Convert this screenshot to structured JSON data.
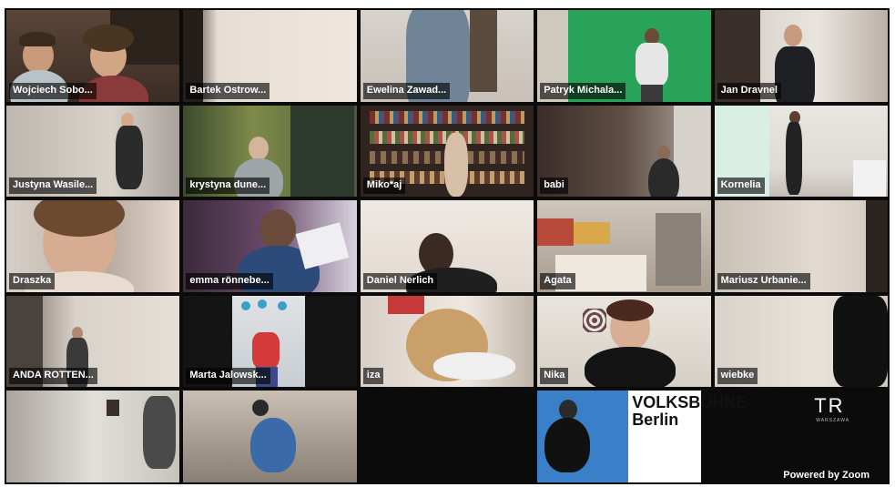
{
  "meeting": {
    "participants": [
      {
        "name": "Wojciech Sobo...",
        "active": false
      },
      {
        "name": "Bartek Ostrow...",
        "active": false
      },
      {
        "name": "Ewelina Zawad...",
        "active": false
      },
      {
        "name": "Patryk Michala...",
        "active": false
      },
      {
        "name": "Jan Dravnel",
        "active": false
      },
      {
        "name": "Justyna Wasile...",
        "active": true
      },
      {
        "name": "krystyna dune...",
        "active": false
      },
      {
        "name": "Miko*aj",
        "active": false
      },
      {
        "name": "babi",
        "active": false
      },
      {
        "name": "Kornelia",
        "active": false
      },
      {
        "name": "Draszka",
        "active": false
      },
      {
        "name": "emma rönnebe...",
        "active": false
      },
      {
        "name": "Daniel Nerlich",
        "active": false
      },
      {
        "name": "Agata",
        "active": false
      },
      {
        "name": "Mariusz Urbanie...",
        "active": false
      },
      {
        "name": "ANDA ROTTEN...",
        "active": false
      },
      {
        "name": "Marta Jalowsk...",
        "active": false
      },
      {
        "name": "iza",
        "active": false
      },
      {
        "name": "Nika",
        "active": false
      },
      {
        "name": "wiebke",
        "active": false
      }
    ],
    "watermark": {
      "line1": "VOLKSBÜHNE",
      "line2": "Berlin",
      "logo": "TR",
      "logo_sub": "WARSZAWA"
    },
    "powered_by": "Powered by Zoom",
    "colors": {
      "active_speaker": "#3fd03a",
      "green_screen": "#2aa35a"
    }
  }
}
